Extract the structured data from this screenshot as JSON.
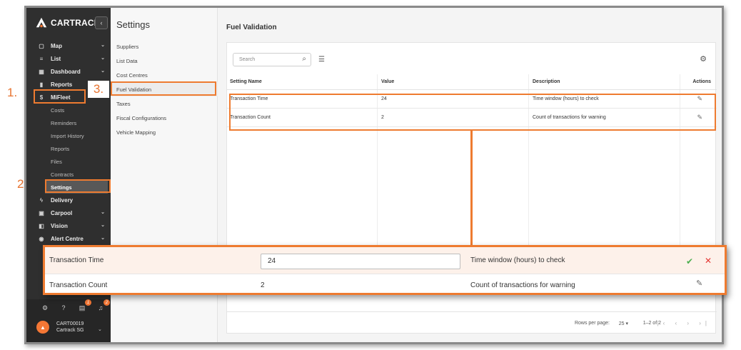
{
  "app": {
    "brand": "CARTRACK",
    "collapse_icon": "chevron-left-icon"
  },
  "sidebar": {
    "items": [
      {
        "label": "Map",
        "icon": "map-icon",
        "glyph": "▢",
        "has_chevron": true
      },
      {
        "label": "List",
        "icon": "list-icon",
        "glyph": "≡",
        "has_chevron": true
      },
      {
        "label": "Dashboard",
        "icon": "dashboard-icon",
        "glyph": "▦",
        "has_chevron": true
      },
      {
        "label": "Reports",
        "icon": "bar-chart-icon",
        "glyph": "▮",
        "has_chevron": false
      },
      {
        "label": "MiFleet",
        "icon": "dollar-icon",
        "glyph": "$",
        "has_chevron": false
      }
    ],
    "mifleet_sub": [
      "Costs",
      "Reminders",
      "Import History",
      "Reports",
      "Files",
      "Contracts",
      "Settings"
    ],
    "items_after": [
      {
        "label": "Delivery",
        "icon": "lightning-icon",
        "glyph": "ϟ",
        "has_chevron": false
      },
      {
        "label": "Carpool",
        "icon": "calendar-icon",
        "glyph": "▣",
        "has_chevron": true
      },
      {
        "label": "Vision",
        "icon": "camera-icon",
        "glyph": "◧",
        "has_chevron": true
      },
      {
        "label": "Alert Centre",
        "icon": "alert-icon",
        "glyph": "◉",
        "has_chevron": true
      }
    ],
    "badges": {
      "notifications_a": "1",
      "notifications_b": "2"
    },
    "user": {
      "account": "CART00019",
      "company": "Cartrack SG"
    }
  },
  "settings_nav": {
    "title": "Settings",
    "items": [
      "Suppliers",
      "List Data",
      "Cost Centres",
      "Fuel Validation",
      "Taxes",
      "Fiscal Configurations",
      "Vehicle Mapping"
    ],
    "active": "Fuel Validation"
  },
  "main": {
    "title": "Fuel Validation",
    "search_placeholder": "Search",
    "table": {
      "headers": [
        "Setting Name",
        "Value",
        "Description",
        "Actions"
      ],
      "rows": [
        {
          "name": "Transaction Time",
          "value": "24",
          "description": "Time window (hours) to check"
        },
        {
          "name": "Transaction Count",
          "value": "2",
          "description": "Count of transactions for warning"
        }
      ]
    },
    "footer": {
      "rows_per_page_label": "Rows per page:",
      "rows_per_page_value": "25 ▾",
      "range": "1–2 of 2"
    }
  },
  "annotations": {
    "step1": "1.",
    "step2": "2.",
    "step3": "3.",
    "accent": "#ee7b30"
  },
  "zoom": {
    "rows": [
      {
        "name": "Transaction Time",
        "value": "24",
        "description": "Time window (hours) to check"
      },
      {
        "name": "Transaction Count",
        "value": "2",
        "description": "Count of transactions for warning"
      }
    ]
  }
}
